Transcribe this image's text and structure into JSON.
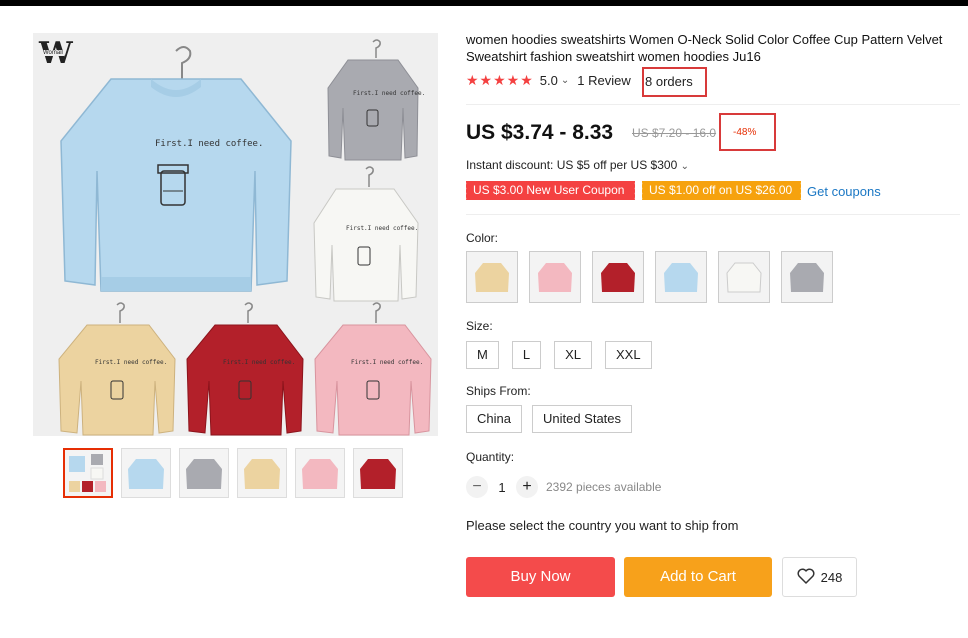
{
  "product": {
    "brand": "Womail",
    "title": "women hoodies sweatshirts Women O-Neck Solid Color Coffee Cup Pattern Velvet Sweatshirt fashion sweatshirt women hoodies Ju16",
    "rating": "5.0",
    "stars": "★★★★★",
    "reviews": "1 Review",
    "orders": "8 orders",
    "price": "US $3.74 - 8.33",
    "old_price": "US $7.20 - 16.0",
    "discount": "-48%",
    "shirt_caption": "First.I need coffee."
  },
  "promo": {
    "instant_discount": "Instant discount: US $5 off per US $300",
    "coupon_new_user": "US $3.00 New User Coupon",
    "coupon_store": "US $1.00 off on US $26.00",
    "get_coupons": "Get coupons"
  },
  "colors": {
    "label": "Color:",
    "swatches": [
      "#ecd3a0",
      "#f3b8c0",
      "#b3202a",
      "#b6d8ee",
      "#f7f7f4",
      "#a9aab0"
    ]
  },
  "size": {
    "label": "Size:",
    "options": [
      "M",
      "L",
      "XL",
      "XXL"
    ]
  },
  "ships_from": {
    "label": "Ships From:",
    "options": [
      "China",
      "United States"
    ]
  },
  "quantity": {
    "label": "Quantity:",
    "minus": "−",
    "value": "1",
    "plus": "+",
    "available": "2392 pieces available"
  },
  "ship_note": "Please select the country you want to ship from",
  "actions": {
    "buy_now": "Buy Now",
    "add_to_cart": "Add to Cart",
    "wishlist_count": "248"
  },
  "gallery": {
    "thumb_colors": [
      "multi",
      "#b6d8ee",
      "#a9aab0",
      "#ecd3a0",
      "#f3b8c0",
      "#b3202a"
    ]
  },
  "accent": {
    "red": "#f44141",
    "orange": "#f6a20e",
    "link": "#1a77c4"
  }
}
